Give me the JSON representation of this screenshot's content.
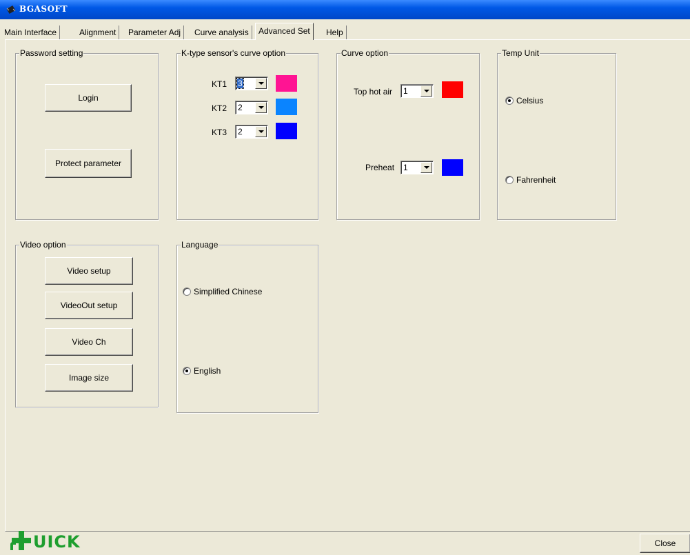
{
  "window": {
    "title": "BGASOFT",
    "icon": "app-chip-icon"
  },
  "tabs": [
    {
      "label": "Main Interface"
    },
    {
      "label": "Alignment"
    },
    {
      "label": "Parameter Adj"
    },
    {
      "label": "Curve analysis"
    },
    {
      "label": "Advanced Set",
      "active": true
    },
    {
      "label": "Help"
    }
  ],
  "password_setting": {
    "legend": "Password setting",
    "login_label": "Login",
    "protect_label": "Protect parameter"
  },
  "ktype": {
    "legend": "K-type sensor's curve option",
    "rows": [
      {
        "label": "KT1",
        "value": "3",
        "color": "#ff1493"
      },
      {
        "label": "KT2",
        "value": "2",
        "color": "#0a84ff"
      },
      {
        "label": "KT3",
        "value": "2",
        "color": "#0000ff"
      }
    ]
  },
  "curve_option": {
    "legend": "Curve option",
    "top_hot_air": {
      "label": "Top hot air",
      "value": "1",
      "color": "#ff0000"
    },
    "preheat": {
      "label": "Preheat",
      "value": "1",
      "color": "#0000ff"
    }
  },
  "temp_unit": {
    "legend": "Temp Unit",
    "options": [
      {
        "label": "Celsius",
        "selected": true
      },
      {
        "label": "Fahrenheit",
        "selected": false
      }
    ]
  },
  "video_option": {
    "legend": "Video option",
    "buttons": [
      "Video setup",
      "VideoOut setup",
      "Video Ch",
      "Image size"
    ]
  },
  "language": {
    "legend": "Language",
    "options": [
      {
        "label": "Simplified Chinese",
        "selected": false
      },
      {
        "label": "English",
        "selected": true
      }
    ]
  },
  "footer": {
    "logo_text": "UICK",
    "close_label": "Close",
    "logo_color": "#1e9e2e"
  }
}
